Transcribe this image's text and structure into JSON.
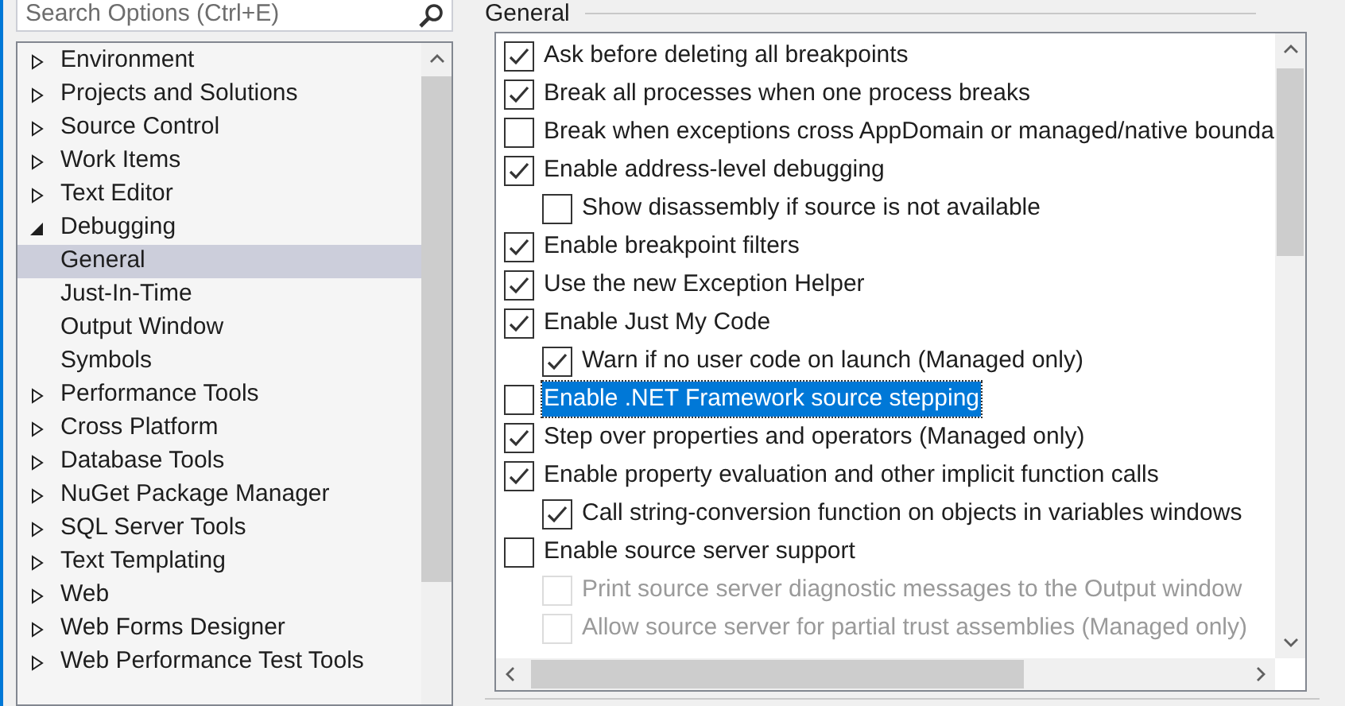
{
  "search": {
    "placeholder": "Search Options (Ctrl+E)"
  },
  "tree": [
    {
      "label": "Environment",
      "expanded": false,
      "selected": false
    },
    {
      "label": "Projects and Solutions",
      "expanded": false,
      "selected": false
    },
    {
      "label": "Source Control",
      "expanded": false,
      "selected": false
    },
    {
      "label": "Work Items",
      "expanded": false,
      "selected": false
    },
    {
      "label": "Text Editor",
      "expanded": false,
      "selected": false
    },
    {
      "label": "Debugging",
      "expanded": true,
      "selected": false,
      "children": [
        {
          "label": "General",
          "selected": true
        },
        {
          "label": "Just-In-Time",
          "selected": false
        },
        {
          "label": "Output Window",
          "selected": false
        },
        {
          "label": "Symbols",
          "selected": false
        }
      ]
    },
    {
      "label": "Performance Tools",
      "expanded": false,
      "selected": false
    },
    {
      "label": "Cross Platform",
      "expanded": false,
      "selected": false
    },
    {
      "label": "Database Tools",
      "expanded": false,
      "selected": false
    },
    {
      "label": "NuGet Package Manager",
      "expanded": false,
      "selected": false
    },
    {
      "label": "SQL Server Tools",
      "expanded": false,
      "selected": false
    },
    {
      "label": "Text Templating",
      "expanded": false,
      "selected": false
    },
    {
      "label": "Web",
      "expanded": false,
      "selected": false
    },
    {
      "label": "Web Forms Designer",
      "expanded": false,
      "selected": false
    },
    {
      "label": "Web Performance Test Tools",
      "expanded": false,
      "selected": false
    }
  ],
  "section_title": "General",
  "options": [
    {
      "label": "Ask before deleting all breakpoints",
      "checked": true,
      "selected": false,
      "disabled": false
    },
    {
      "label": "Break all processes when one process breaks",
      "checked": true,
      "selected": false,
      "disabled": false
    },
    {
      "label": "Break when exceptions cross AppDomain or managed/native bounda",
      "checked": false,
      "selected": false,
      "disabled": false
    },
    {
      "label": "Enable address-level debugging",
      "checked": true,
      "selected": false,
      "disabled": false,
      "children": [
        {
          "label": "Show disassembly if source is not available",
          "checked": false,
          "selected": false,
          "disabled": false
        }
      ]
    },
    {
      "label": "Enable breakpoint filters",
      "checked": true,
      "selected": false,
      "disabled": false
    },
    {
      "label": "Use the new Exception Helper",
      "checked": true,
      "selected": false,
      "disabled": false
    },
    {
      "label": "Enable Just My Code",
      "checked": true,
      "selected": false,
      "disabled": false,
      "children": [
        {
          "label": "Warn if no user code on launch (Managed only)",
          "checked": true,
          "selected": false,
          "disabled": false
        }
      ]
    },
    {
      "label": "Enable .NET Framework source stepping",
      "checked": false,
      "selected": true,
      "disabled": false
    },
    {
      "label": "Step over properties and operators (Managed only)",
      "checked": true,
      "selected": false,
      "disabled": false
    },
    {
      "label": "Enable property evaluation and other implicit function calls",
      "checked": true,
      "selected": false,
      "disabled": false,
      "children": [
        {
          "label": "Call string-conversion function on objects in variables windows",
          "checked": true,
          "selected": false,
          "disabled": false
        }
      ]
    },
    {
      "label": "Enable source server support",
      "checked": false,
      "selected": false,
      "disabled": false,
      "children": [
        {
          "label": "Print source server diagnostic messages to the Output window",
          "checked": false,
          "selected": false,
          "disabled": true
        },
        {
          "label": "Allow source server for partial trust assemblies (Managed only)",
          "checked": false,
          "selected": false,
          "disabled": true
        }
      ]
    }
  ]
}
